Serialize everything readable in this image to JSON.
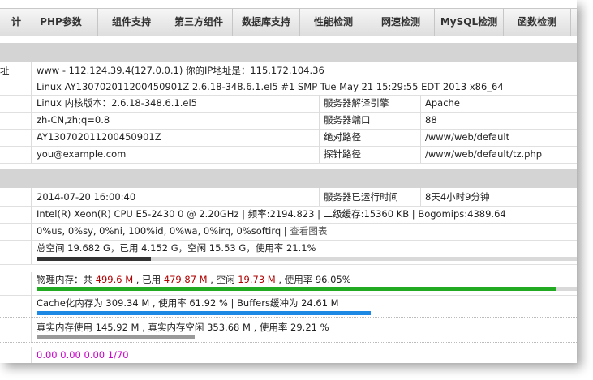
{
  "nav": {
    "items": [
      "计",
      "PHP参数",
      "组件支持",
      "第三方组件",
      "数据库支持",
      "性能检测",
      "网速检测",
      "MySQL检测",
      "函数检测"
    ]
  },
  "server": {
    "addr_label": "址",
    "addr_value": "www - 112.124.39.4(127.0.0.1)  你的IP地址是：115.172.104.36",
    "os_value": "Linux AY130702011200450901Z 2.6.18-348.6.1.el5 #1 SMP Tue May 21 15:29:55 EDT 2013 x86_64",
    "kernel_value": "Linux  内核版本：2.6.18-348.6.1.el5",
    "engine_label": "服务器解译引擎",
    "engine_value": "Apache",
    "lang_value": "zh-CN,zh;q=0.8",
    "port_label": "服务器端口",
    "port_value": "88",
    "host_value": "AY130702011200450901Z",
    "path_label": "绝对路径",
    "path_value": "/www/web/default",
    "email_value": "you@example.com",
    "probe_label": "探针路径",
    "probe_value": "/www/web/default/tz.php"
  },
  "realtime": {
    "time_value": "2014-07-20 16:00:40",
    "uptime_label": "服务器已运行时间",
    "uptime_value": "8天4小时9分钟",
    "cpu_value": "Intel(R) Xeon(R) CPU E5-2430 0 @ 2.20GHz | 频率:2194.823 | 二级缓存:15360 KB | Bogomips:4389.64",
    "cpu_usage": "0%us, 0%sy, 0%ni, 100%id, 0%wa, 0%irq, 0%softirq",
    "cpu_sep": " | ",
    "chart_link": "查看图表",
    "disk": {
      "prefix": "总空间 ",
      "total": "19.682 G",
      "used_label": "，已用 ",
      "used": "4.152 G",
      "free_label": "，空闲 ",
      "free": "15.53 G",
      "rate_label": "，使用率 ",
      "rate": "21.1%",
      "fraction": 0.211,
      "color": "#333333"
    },
    "mem": {
      "prefix": "物理内存：共 ",
      "total": "499.6 M",
      "used_label": " , 已用 ",
      "used": "479.87 M",
      "free_label": " , 空闲 ",
      "free": "19.73 M",
      "rate_label": " , 使用率 ",
      "rate": "96.05%",
      "fraction": 0.9605,
      "color": "#22aa22"
    },
    "cache": {
      "text": "Cache化内存为 309.34 M , 使用率 61.92 % | Buffers缓冲为 24.61 M",
      "fraction": 0.6192,
      "color": "#1e88e5"
    },
    "real": {
      "text": "真实内存使用 145.92 M , 真实内存空闲 353.68 M , 使用率 29.21 %",
      "fraction": 0.2921,
      "color": "#9a9a9a"
    },
    "load_value": "0.00 0.00 0.00 1/70"
  }
}
